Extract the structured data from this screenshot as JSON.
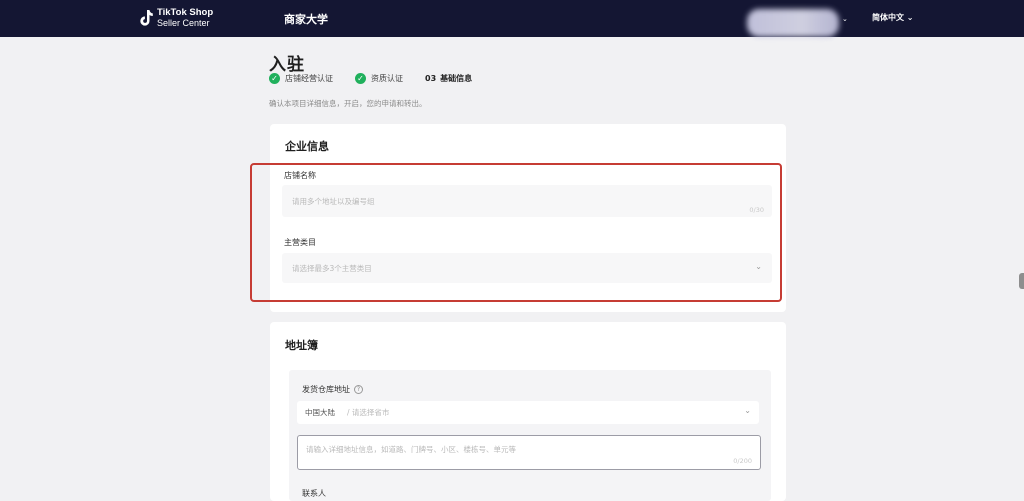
{
  "topbar": {
    "logo_line1": "TikTok Shop",
    "logo_line2": "Seller Center",
    "nav_academy": "商家大学",
    "account_caret": "⌄",
    "language": "简体中文 ⌄"
  },
  "page": {
    "title": "入驻",
    "steps": [
      {
        "label": "店铺经营认证",
        "done": true
      },
      {
        "label": "资质认证",
        "done": true
      },
      {
        "num": "03",
        "label": "基础信息",
        "done": false
      }
    ],
    "subtitle": "确认本项目详细信息，开启，您的申请和转出。"
  },
  "business_info": {
    "title": "企业信息",
    "shop_name_label": "店铺名称",
    "shop_name_placeholder": "请用多个地址以及编号组",
    "shop_name_counter": "0/30",
    "category_label": "主营类目",
    "category_placeholder": "请选择最多3个主营类目"
  },
  "address": {
    "title": "地址簿",
    "warehouse_label": "发货仓库地址",
    "region_value": "中国大陆",
    "region_placeholder": "/ 请选择省市",
    "detail_placeholder": "请输入详细地址信息，如道路、门牌号、小区、楼栋号、单元等",
    "detail_counter": "0/200",
    "contact_label": "联系人"
  },
  "colors": {
    "topbar": "#141633",
    "highlight": "#c63c34",
    "check": "#20b05c"
  }
}
